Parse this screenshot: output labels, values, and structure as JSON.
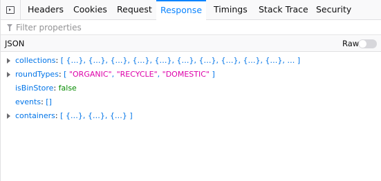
{
  "tabs": [
    {
      "label": "Headers"
    },
    {
      "label": "Cookies"
    },
    {
      "label": "Request"
    },
    {
      "label": "Response",
      "active": true
    },
    {
      "label": "Timings"
    },
    {
      "label": "Stack Trace"
    },
    {
      "label": "Security"
    }
  ],
  "icons": {
    "panel_toggle": "sidebar-toggle-icon",
    "filter": "filter-icon",
    "expand": "triangle-right-icon"
  },
  "colors": {
    "accent": "#0a84ff",
    "key": "#0074e8",
    "string": "#dd00a9",
    "boolean": "#058b00"
  },
  "filter": {
    "placeholder": "Filter properties",
    "value": ""
  },
  "json_section": {
    "title": "JSON",
    "raw_label": "Raw",
    "raw_enabled": false
  },
  "tree": [
    {
      "key": "collections",
      "sep": ":",
      "value": "[ {…}, {…}, {…}, {…}, {…}, {…}, {…}, {…}, {…}, {…}, … ]",
      "expandable": true
    },
    {
      "key": "roundTypes",
      "sep": ":",
      "open": "[ ",
      "items": [
        "\"ORGANIC\"",
        "\"RECYCLE\"",
        "\"DOMESTIC\""
      ],
      "comma": ", ",
      "close": " ]",
      "expandable": true
    },
    {
      "key": "isBinStore",
      "sep": ":",
      "value": "false",
      "expandable": false
    },
    {
      "key": "events",
      "sep": ":",
      "value": "[]",
      "expandable": false
    },
    {
      "key": "containers",
      "sep": ":",
      "value": "[ {…}, {…}, {…} ]",
      "expandable": true
    }
  ]
}
